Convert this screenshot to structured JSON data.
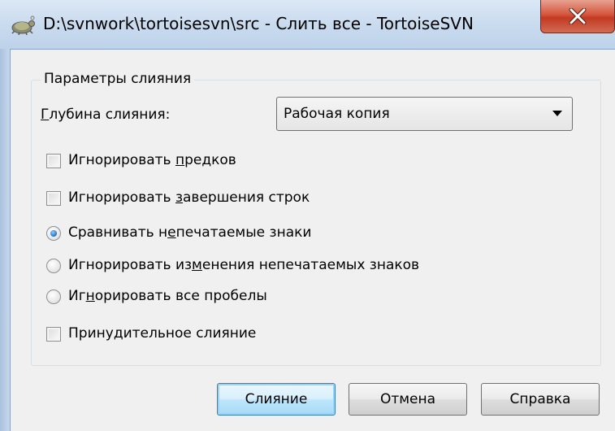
{
  "window": {
    "title": "D:\\svnwork\\tortoisesvn\\src - Слить все - TortoiseSVN",
    "app_icon": "tortoise-icon",
    "close_icon": "close-x-icon",
    "close_button_color": "#c9442b"
  },
  "group": {
    "legend": "Параметры слияния"
  },
  "depth": {
    "label_first": "Г",
    "label_rest": "лубина слияния:",
    "selected": "Рабочая копия"
  },
  "options": {
    "ignore_ancestry": {
      "pre": "Игнорировать ",
      "u": "п",
      "post": "редков",
      "checked": false
    },
    "ignore_eol": {
      "pre": "Игнорировать ",
      "u": "з",
      "post": "авершения строк",
      "checked": false
    },
    "compare_whitespace": {
      "pre": "Сравнивать н",
      "u": "е",
      "post": "печатаемые знаки",
      "selected": true
    },
    "ignore_ws_changes": {
      "pre": "Игнорировать из",
      "u": "м",
      "post": "енения непечатаемых знаков",
      "selected": false
    },
    "ignore_all_ws": {
      "pre": "Иг",
      "u": "н",
      "post": "орировать все пробелы",
      "selected": false
    },
    "force_merge": {
      "pre": "Прину",
      "u": "д",
      "post": "ительное слияние",
      "checked": false
    }
  },
  "buttons": {
    "merge": "Слияние",
    "cancel": "Отмена",
    "help": "Справка"
  },
  "colors": {
    "title_bar": "#c8daee",
    "dialog_bg": "#f0f0f0",
    "default_button_border": "#3c7fb1",
    "radio_selected": "#1c6fc8"
  }
}
